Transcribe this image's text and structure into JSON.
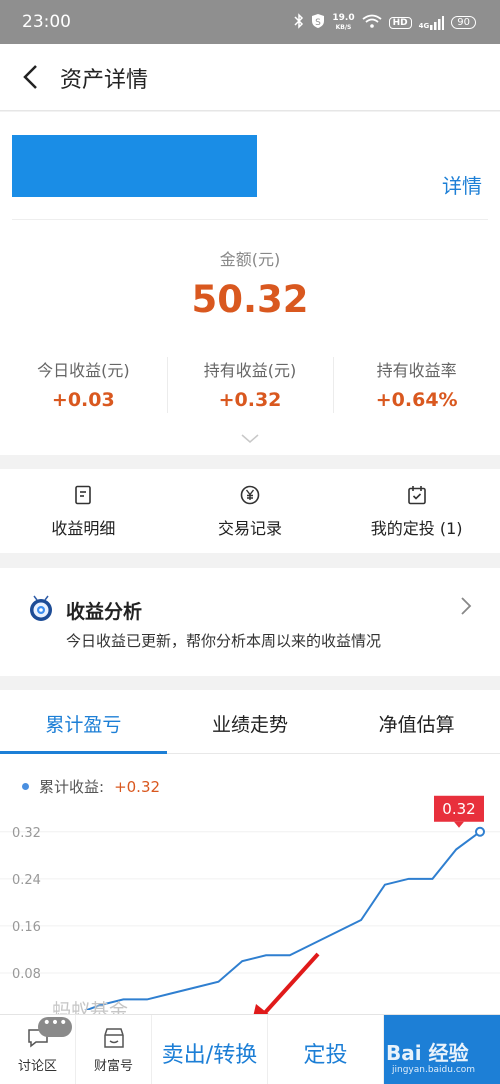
{
  "status": {
    "time": "23:00",
    "speed_top": "19.0",
    "speed_unit": "KB/S",
    "hd": "HD",
    "network": "4G",
    "battery": "90"
  },
  "header": {
    "title": "资产详情"
  },
  "summary": {
    "detail_link": "详情",
    "amount_label": "金额(元)",
    "amount_value": "50.32",
    "stats": [
      {
        "label": "今日收益(元)",
        "value": "+0.03"
      },
      {
        "label": "持有收益(元)",
        "value": "+0.32"
      },
      {
        "label": "持有收益率",
        "value": "+0.64%"
      }
    ]
  },
  "quick_actions": [
    {
      "label": "收益明细",
      "icon": "document-icon"
    },
    {
      "label": "交易记录",
      "icon": "yen-circle-icon"
    },
    {
      "label": "我的定投 (1)",
      "icon": "calendar-check-icon"
    }
  ],
  "analysis": {
    "title": "收益分析",
    "subtitle": "今日收益已更新，帮你分析本周以来的收益情况"
  },
  "tabs": [
    "累计盈亏",
    "业绩走势",
    "净值估算"
  ],
  "active_tab": 0,
  "legend": {
    "label": "累计收益:",
    "value": "+0.32"
  },
  "watermark": "蚂蚁基金",
  "chart_data": {
    "type": "line",
    "y_ticks": [
      "0.32",
      "0.24",
      "0.16",
      "0.08"
    ],
    "ylim": [
      0.0,
      0.34
    ],
    "x": [
      0,
      1,
      2,
      3,
      4,
      5,
      6,
      7,
      8,
      9,
      10,
      11,
      12,
      13,
      14,
      15,
      16,
      17,
      18
    ],
    "series": [
      {
        "values": [
          0.0,
          0.01,
          0.025,
          0.035,
          0.035,
          0.045,
          0.055,
          0.065,
          0.1,
          0.11,
          0.11,
          0.13,
          0.15,
          0.17,
          0.23,
          0.24,
          0.24,
          0.29,
          0.32
        ]
      }
    ],
    "end_label": "0.32",
    "line_color": "#2f7fd0",
    "label_color": "#e8303c"
  },
  "bottom": {
    "discuss": "讨论区",
    "wealth": "财富号",
    "sell": "卖出/转换",
    "invest": "定投",
    "buy_watermark": "Bai 经验",
    "buy_watermark_url": "jingyan.baidu.com"
  }
}
